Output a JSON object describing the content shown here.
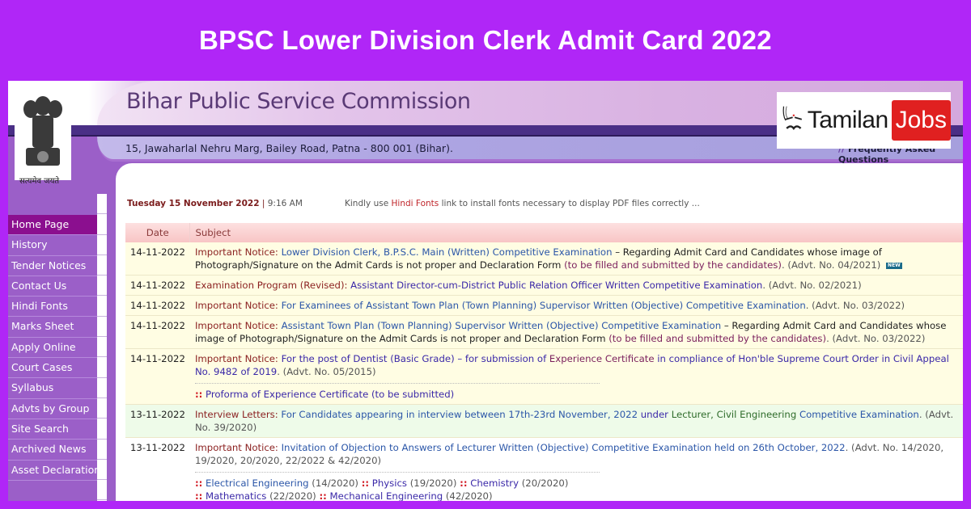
{
  "banner": {
    "title": "BPSC Lower Division Clerk Admit Card 2022"
  },
  "header": {
    "site_title": "Bihar Public Service Commission",
    "address": "15, Jawaharlal Nehru Marg, Bailey Road, Patna - 800 001 (Bihar).",
    "faq_link": "Frequently Asked Questions",
    "emblem_motto": "सत्यमेव जयते"
  },
  "watermark": {
    "brand": "Tamilan",
    "brand_highlight": "Jobs"
  },
  "sidebar": {
    "items": [
      {
        "label": "Home Page",
        "active": true
      },
      {
        "label": "History"
      },
      {
        "label": "Tender Notices"
      },
      {
        "label": "Contact Us"
      },
      {
        "label": "Hindi Fonts"
      },
      {
        "label": "Marks Sheet"
      },
      {
        "label": "Apply Online"
      },
      {
        "label": "Court Cases"
      },
      {
        "label": "Syllabus"
      },
      {
        "label": "Advts by Group"
      },
      {
        "label": "Site Search"
      },
      {
        "label": "Archived News"
      },
      {
        "label": "Asset Declaration"
      }
    ]
  },
  "content": {
    "date": "Tuesday 15 November 2022",
    "time": "9:16 AM",
    "font_note_prefix": "Kindly use",
    "font_note_link": "Hindi Fonts",
    "font_note_suffix": "link to install fonts necessary to display PDF files correctly ...",
    "table": {
      "headers": [
        "Date",
        "Subject"
      ],
      "rows": [
        {
          "date": "14-11-2022",
          "label": "Important Notice:",
          "link": "Lower Division Clerk, B.P.S.C. Main (Written) Competitive Examination",
          "text": " – Regarding Admit Card and Candidates whose image of Photograph/Signature on the Admit Cards is not proper and Declaration Form ",
          "link2": "(to be filled and submitted by the candidates)",
          "advt": ". (Advt. No. 04/2021)",
          "badge": "NEW"
        },
        {
          "date": "14-11-2022",
          "label": "Examination Program (Revised):",
          "link": "Assistant Director-cum-District Public Relation Officer Written Competitive Examination",
          "advt": ". (Advt. No. 02/2021)"
        },
        {
          "date": "14-11-2022",
          "label": "Important Notice:",
          "link": "For Examinees of Assistant Town Plan (Town Planning) Supervisor Written (Objective) Competitive Examination",
          "advt": ". (Advt. No. 03/2022)"
        },
        {
          "date": "14-11-2022",
          "label": "Important Notice:",
          "link": "Assistant Town Plan (Town Planning) Supervisor Written (Objective) Competitive Examination",
          "text": " – Regarding Admit Card and Candidates whose image of Photograph/Signature on the Admit Cards is not proper and Declaration Form ",
          "link2": "(to be filled and submitted by the candidates)",
          "advt": ". (Advt. No. 03/2022)"
        },
        {
          "date": "14-11-2022",
          "label": "Important Notice:",
          "link": "For the post of Dentist (Basic Grade) – for submission of",
          "link2": "Experience Certificate",
          "link3": "in compliance of Hon'ble Supreme Court Order in Civil Appeal No. 9482 of 2019",
          "advt": ". (Advt. No. 05/2015)",
          "sub_link": "Proforma of Experience Certificate (to be submitted)"
        },
        {
          "date": "13-11-2022",
          "label": "Interview Letters:",
          "link": "For Candidates appearing in interview between 17th-23rd November, 2022",
          "text": " under ",
          "link2": "Lecturer, Civil Engineering",
          "link3": " Competitive Examination",
          "advt": ". (Advt. No. 39/2020)"
        },
        {
          "date": "13-11-2022",
          "label": "Important Notice:",
          "link": "Invitation of Objection to Answers of Lecturer Written (Objective) Competitive Examination held on 26th October, 2022",
          "advt": ". (Advt. No. 14/2020, 19/2020, 20/2020, 22/2022 & 42/2020)",
          "subjects": [
            {
              "name": "Electrical Engineering",
              "advt": "(14/2020)"
            },
            {
              "name": "Physics",
              "advt": "(19/2020)"
            },
            {
              "name": "Chemistry",
              "advt": "(20/2020)"
            },
            {
              "name": "Mathematics",
              "advt": "(22/2020)"
            },
            {
              "name": "Mechanical Engineering",
              "advt": "(42/2020)"
            }
          ]
        }
      ]
    }
  }
}
